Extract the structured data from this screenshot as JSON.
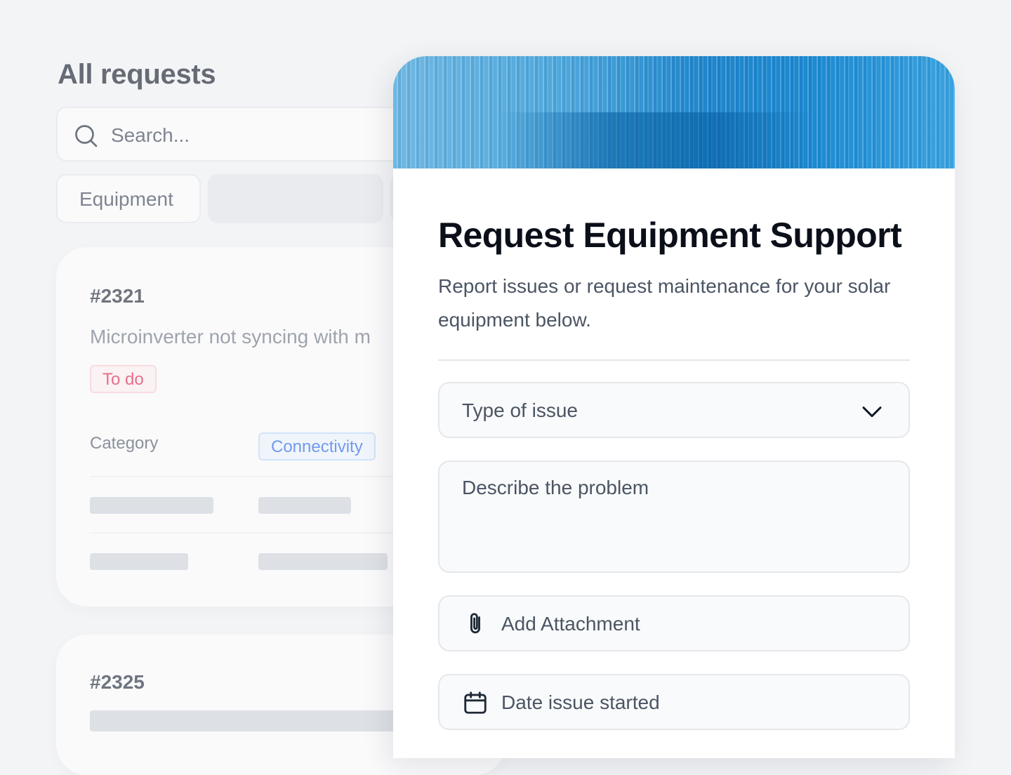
{
  "list": {
    "title": "All requests",
    "search_placeholder": "Search...",
    "filter_chip": "Equipment",
    "requests": [
      {
        "id": "#2321",
        "description": "Microinverter not syncing with m",
        "status": "To do",
        "category_label": "Category",
        "category": "Connectivity"
      },
      {
        "id": "#2325"
      }
    ]
  },
  "form": {
    "title": "Request Equipment Support",
    "subtitle": "Report issues or request maintenance for your solar equipment below.",
    "fields": {
      "issue_type_placeholder": "Type of issue",
      "problem_placeholder": "Describe the problem",
      "attachment_label": "Add Attachment",
      "date_placeholder": "Date issue started"
    }
  },
  "icons": {
    "search": "search-icon",
    "chevron": "chevron-down-icon",
    "attachment": "paperclip-icon",
    "calendar": "calendar-icon"
  },
  "colors": {
    "status_todo": "#e11d48",
    "category_badge": "#2563eb",
    "banner_blue": "#1f86cc"
  }
}
